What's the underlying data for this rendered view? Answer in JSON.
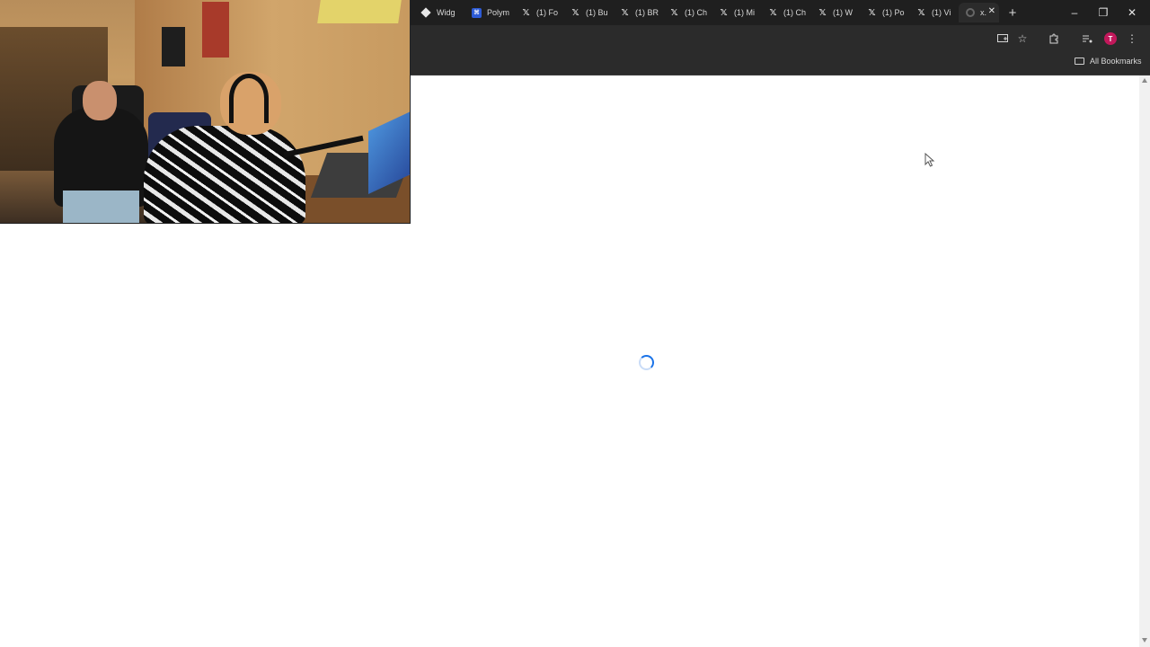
{
  "browser": {
    "tabs": [
      {
        "icon": "widget-icon",
        "label": "Widg"
      },
      {
        "icon": "polymarket-icon",
        "label": "Polym"
      },
      {
        "icon": "x-icon",
        "label": "(1) Fo"
      },
      {
        "icon": "x-icon",
        "label": "(1) Bu"
      },
      {
        "icon": "x-icon",
        "label": "(1) BR"
      },
      {
        "icon": "x-icon",
        "label": "(1) Ch"
      },
      {
        "icon": "x-icon",
        "label": "(1) Mi"
      },
      {
        "icon": "x-icon",
        "label": "(1) Ch"
      },
      {
        "icon": "x-icon",
        "label": "(1) W"
      },
      {
        "icon": "x-icon",
        "label": "(1) Po"
      },
      {
        "icon": "x-icon",
        "label": "(1) Vi"
      },
      {
        "icon": "loading-globe-icon",
        "label": "x.",
        "active": true
      }
    ],
    "new_tab_symbol": "+",
    "window_controls": {
      "minimize": "–",
      "restore": "❐",
      "close": "✕"
    },
    "toolbar": {
      "avatar_letter": "T"
    },
    "bookmarks_bar": {
      "all_bookmarks_label": "All Bookmarks"
    }
  },
  "page": {
    "state": "loading"
  },
  "colors": {
    "spinner": "#1a73e8",
    "avatar": "#c2185b",
    "tabstrip": "#1f1f1f",
    "toolbar": "#2b2b2b"
  }
}
